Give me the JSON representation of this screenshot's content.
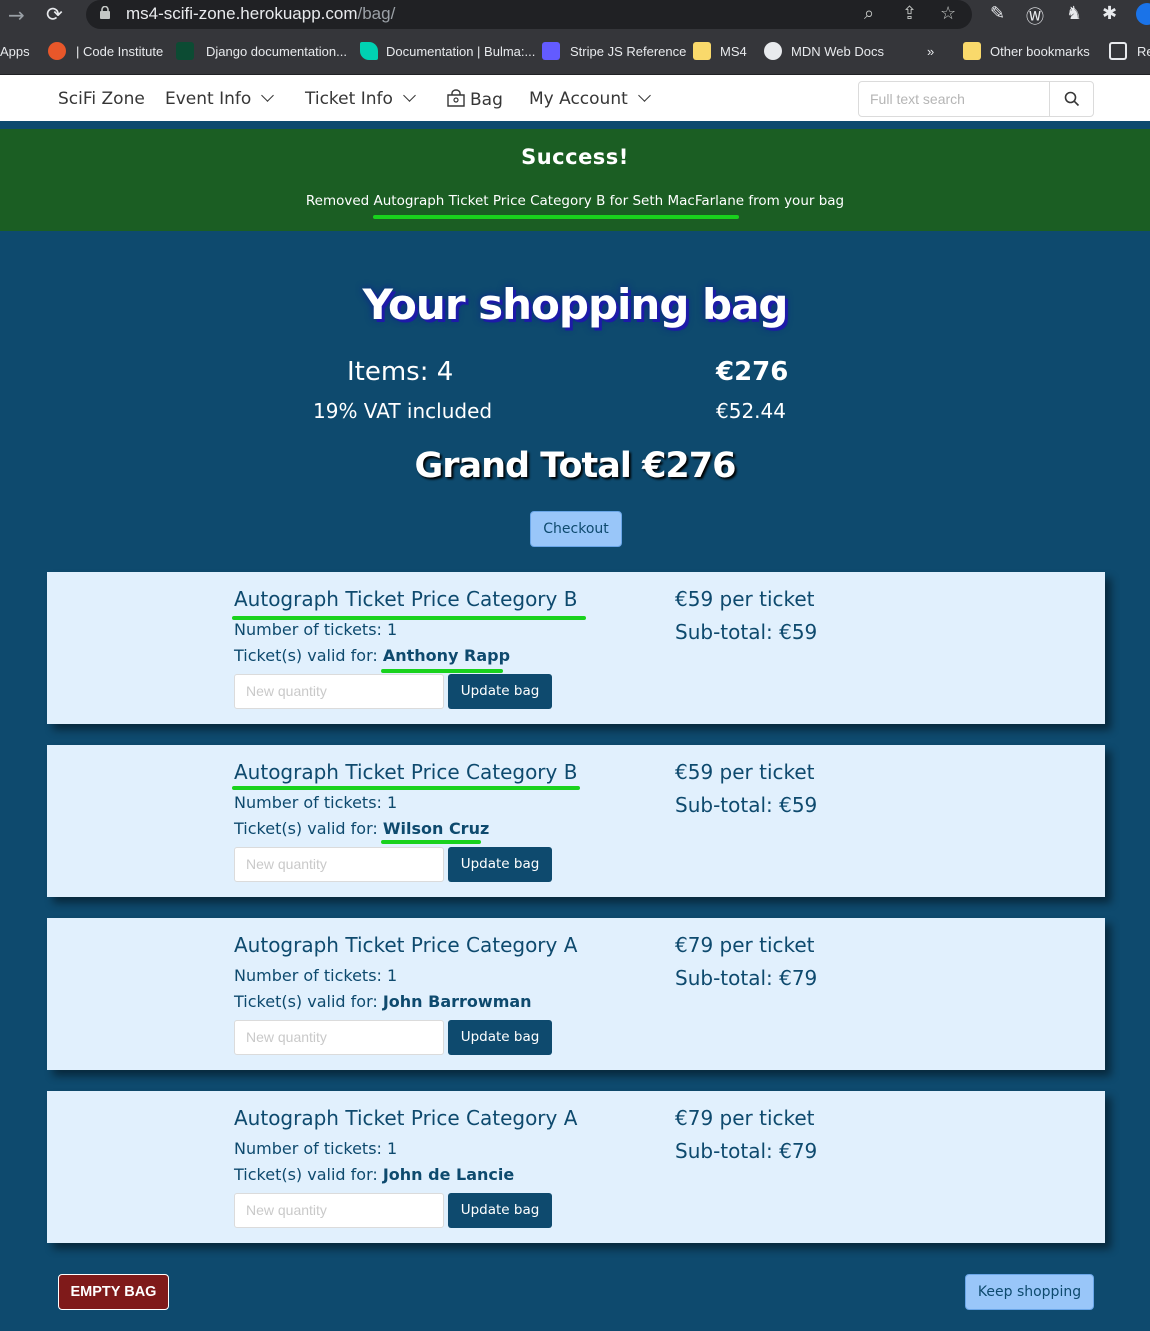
{
  "browser": {
    "url_host": "ms4-scifi-zone.herokuapp.com",
    "url_path": "/bag/",
    "bookmarks": [
      {
        "label": "Apps"
      },
      {
        "label": "| Code Institute"
      },
      {
        "label": "Django documentation..."
      },
      {
        "label": "Documentation | Bulma:..."
      },
      {
        "label": "Stripe JS Reference"
      },
      {
        "label": "MS4"
      },
      {
        "label": "MDN Web Docs"
      },
      {
        "label": "»"
      },
      {
        "label": "Other bookmarks"
      },
      {
        "label": "Re"
      }
    ]
  },
  "navbar": {
    "brand": "SciFi Zone",
    "event_info": "Event Info",
    "ticket_info": "Ticket Info",
    "bag": "Bag",
    "my_account": "My Account",
    "search_placeholder": "Full text search"
  },
  "banner": {
    "title": "Success!",
    "message": "Removed Autograph Ticket Price Category B for Seth MacFarlane from your bag"
  },
  "summary": {
    "title": "Your shopping bag",
    "items_label": "Items: 4",
    "items_total": "€276",
    "vat_label": "19% VAT included",
    "vat_amount": "€52.44",
    "grand_total": "Grand Total €276",
    "checkout": "Checkout"
  },
  "cards": [
    {
      "title": "Autograph Ticket Price Category B",
      "num": "Number of tickets: 1",
      "valid_prefix": "Ticket(s) valid for: ",
      "valid_name": "Anthony Rapp",
      "qty_placeholder": "New quantity",
      "update": "Update bag",
      "per_ticket": "€59 per ticket",
      "subtotal": "Sub-total: €59"
    },
    {
      "title": "Autograph Ticket Price Category B",
      "num": "Number of tickets: 1",
      "valid_prefix": "Ticket(s) valid for: ",
      "valid_name": "Wilson Cruz",
      "qty_placeholder": "New quantity",
      "update": "Update bag",
      "per_ticket": "€59 per ticket",
      "subtotal": "Sub-total: €59"
    },
    {
      "title": "Autograph Ticket Price Category A",
      "num": "Number of tickets: 1",
      "valid_prefix": "Ticket(s) valid for: ",
      "valid_name": "John Barrowman",
      "qty_placeholder": "New quantity",
      "update": "Update bag",
      "per_ticket": "€79 per ticket",
      "subtotal": "Sub-total: €79"
    },
    {
      "title": "Autograph Ticket Price Category A",
      "num": "Number of tickets: 1",
      "valid_prefix": "Ticket(s) valid for: ",
      "valid_name": "John de Lancie",
      "qty_placeholder": "New quantity",
      "update": "Update bag",
      "per_ticket": "€79 per ticket",
      "subtotal": "Sub-total: €79"
    }
  ],
  "footer": {
    "empty_bag": "EMPTY BAG",
    "keep_shopping": "Keep shopping"
  }
}
